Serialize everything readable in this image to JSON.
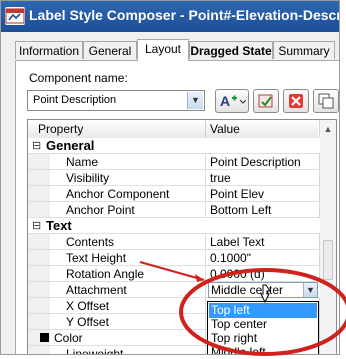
{
  "window": {
    "title": "Label Style Composer - Point#-Elevation-Descrip"
  },
  "tabs": [
    "Information",
    "General",
    "Layout",
    "Dragged State",
    "Summary"
  ],
  "component": {
    "label": "Component name:",
    "value": "Point Description"
  },
  "toolbar_icons": [
    "add-text-icon",
    "settings-icon",
    "delete-icon",
    "copy-icon"
  ],
  "grid": {
    "headers": {
      "property": "Property",
      "value": "Value"
    },
    "general": {
      "label": "General",
      "rows": [
        {
          "name": "Name",
          "value": "Point Description"
        },
        {
          "name": "Visibility",
          "value": "true"
        },
        {
          "name": "Anchor Component",
          "value": "Point Elev"
        },
        {
          "name": "Anchor Point",
          "value": "Bottom Left"
        }
      ]
    },
    "text": {
      "label": "Text",
      "rows": [
        {
          "name": "Contents",
          "value": "Label Text"
        },
        {
          "name": "Text Height",
          "value": "0.1000\""
        },
        {
          "name": "Rotation Angle",
          "value": "0.0000 (d)"
        },
        {
          "name": "Attachment",
          "value": "Middle center"
        },
        {
          "name": "X Offset",
          "value": ""
        },
        {
          "name": "Y Offset",
          "value": ""
        },
        {
          "name": "Color",
          "value": ""
        },
        {
          "name": "Lineweight",
          "value": ""
        }
      ]
    }
  },
  "attachment_options": [
    "Top left",
    "Top center",
    "Top right",
    "Middle left"
  ],
  "attachment_highlighted": "Top left",
  "colors": {
    "title_bar": "#1c4f96",
    "highlight": "#3399ff",
    "callout": "#d0211c"
  }
}
